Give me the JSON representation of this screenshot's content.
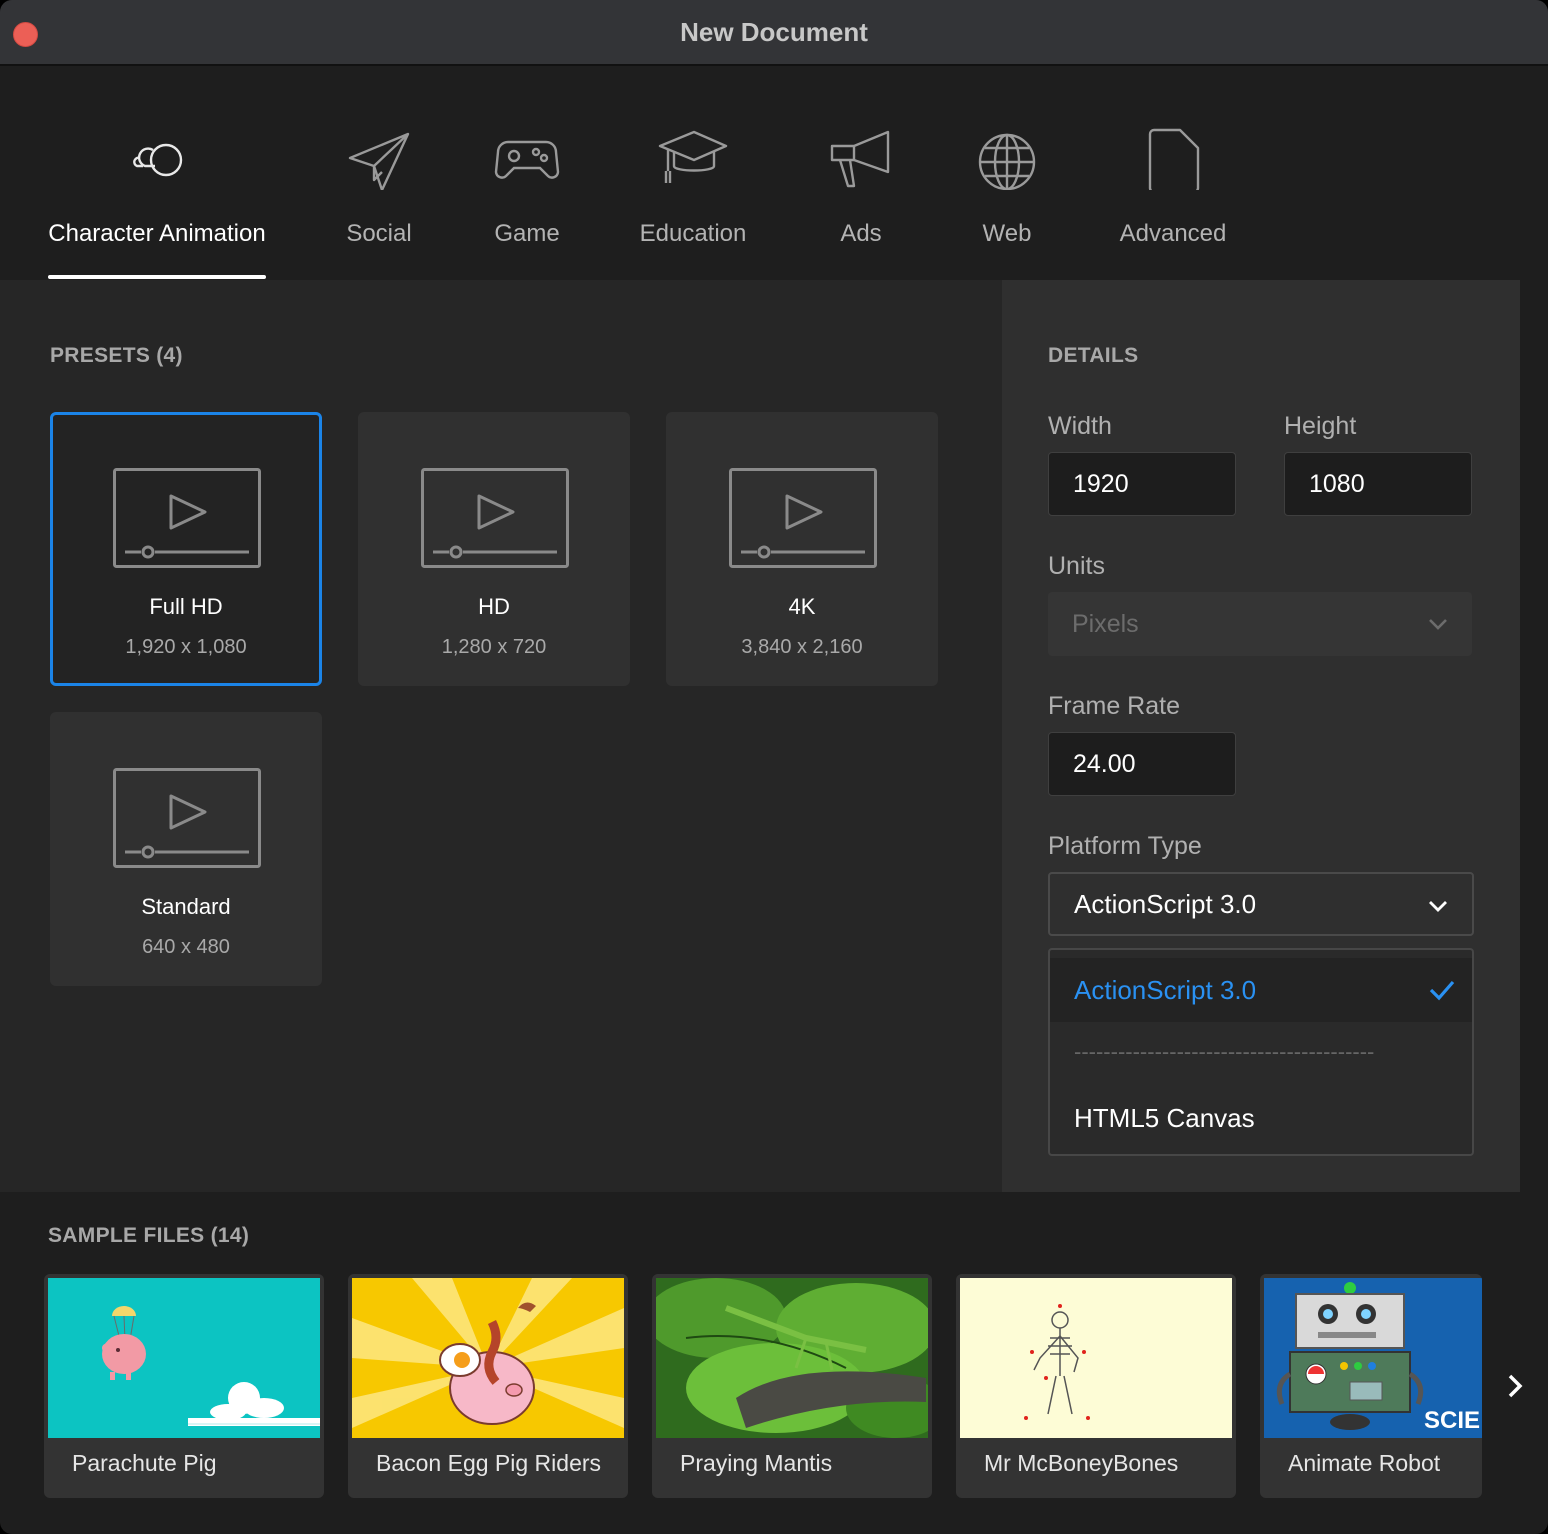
{
  "window": {
    "title": "New Document"
  },
  "tabs": [
    {
      "label": "Character Animation",
      "icon": "character-animation-icon",
      "active": true
    },
    {
      "label": "Social",
      "icon": "paper-plane-icon"
    },
    {
      "label": "Game",
      "icon": "gamepad-icon"
    },
    {
      "label": "Education",
      "icon": "graduation-cap-icon"
    },
    {
      "label": "Ads",
      "icon": "megaphone-icon"
    },
    {
      "label": "Web",
      "icon": "globe-icon"
    },
    {
      "label": "Advanced",
      "icon": "document-icon"
    }
  ],
  "presets": {
    "title": "PRESETS (4)",
    "items": [
      {
        "name": "Full HD",
        "size": "1,920 x 1,080",
        "selected": true
      },
      {
        "name": "HD",
        "size": "1,280 x 720"
      },
      {
        "name": "4K",
        "size": "3,840 x 2,160"
      },
      {
        "name": "Standard",
        "size": "640 x 480"
      }
    ]
  },
  "details": {
    "title": "DETAILS",
    "width_label": "Width",
    "width_value": "1920",
    "height_label": "Height",
    "height_value": "1080",
    "units_label": "Units",
    "units_value": "Pixels",
    "frame_rate_label": "Frame Rate",
    "frame_rate_value": "24.00",
    "platform_label": "Platform Type",
    "platform_value": "ActionScript 3.0",
    "platform_options": [
      {
        "label": "ActionScript 3.0",
        "selected": true
      },
      {
        "label": "-----------------------------------------"
      },
      {
        "label": "HTML5 Canvas"
      }
    ]
  },
  "samples": {
    "title": "SAMPLE FILES (14)",
    "items": [
      {
        "name": "Parachute Pig"
      },
      {
        "name": "Bacon Egg Pig Riders"
      },
      {
        "name": "Praying Mantis"
      },
      {
        "name": "Mr McBoneyBones"
      },
      {
        "name": "Animate Robot",
        "badge": "SCIE"
      }
    ]
  },
  "colors": {
    "accent": "#1b84e8",
    "selected_text": "#2a91f2"
  }
}
